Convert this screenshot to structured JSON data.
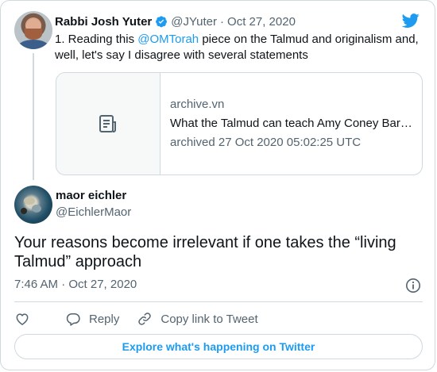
{
  "parent_tweet": {
    "author_name": "Rabbi Josh Yuter",
    "handle": "@JYuter",
    "separator": "·",
    "date": "Oct 27, 2020",
    "text_before": "1. Reading this ",
    "mention": "@OMTorah",
    "text_after": " piece on the Talmud and originalism and, well, let's say I disagree with several statements",
    "link_card": {
      "domain": "archive.vn",
      "title": "What the Talmud can teach Amy Coney Bar…",
      "archived": "archived 27 Oct 2020 05:02:25 UTC",
      "thumb_icon": "document-icon"
    }
  },
  "reply_tweet": {
    "author_name": "maor eichler",
    "handle": "@EichlerMaor",
    "text": "Your reasons become irrelevant if one takes the “living Talmud” approach",
    "timestamp": "7:46 AM · Oct 27, 2020"
  },
  "actions": {
    "like_icon": "heart-icon",
    "reply_label": "Reply",
    "copy_link_label": "Copy link to Tweet"
  },
  "explore_label": "Explore what's happening on Twitter",
  "colors": {
    "accent": "#1d9bf0",
    "text": "#0f1419",
    "secondary": "#536471",
    "border": "#cfd9de"
  }
}
